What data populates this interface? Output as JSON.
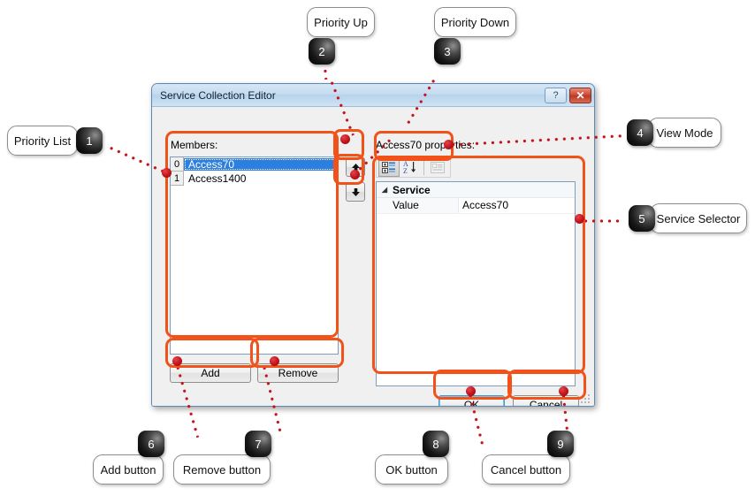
{
  "dialog": {
    "title": "Service Collection Editor",
    "help_button": "?",
    "close_button": "✕",
    "members_label": "Members:",
    "properties_label": "Access70 properties:",
    "members": [
      {
        "index": "0",
        "name": "Access70",
        "selected": true
      },
      {
        "index": "1",
        "name": "Access1400",
        "selected": false
      }
    ],
    "move_up_icon": "arrow-up-icon",
    "move_down_icon": "arrow-down-icon",
    "toolbar": {
      "categorized_icon": "categorized-view-icon",
      "alphabetical_icon": "alphabetical-sort-icon",
      "property_pages_icon": "property-pages-icon"
    },
    "property_grid": {
      "category": "Service",
      "category_triangle": "◢",
      "rows": [
        {
          "name": "Value",
          "value": "Access70"
        }
      ]
    },
    "buttons": {
      "add": "Add",
      "remove": "Remove",
      "ok": "OK",
      "cancel": "Cancel"
    }
  },
  "annotations": [
    {
      "number": "1",
      "label": "Priority List"
    },
    {
      "number": "2",
      "label": "Priority Up"
    },
    {
      "number": "3",
      "label": "Priority Down"
    },
    {
      "number": "4",
      "label": "View Mode"
    },
    {
      "number": "5",
      "label": "Service Selector"
    },
    {
      "number": "6",
      "label": "Add button"
    },
    {
      "number": "7",
      "label": "Remove button"
    },
    {
      "number": "8",
      "label": "OK button"
    },
    {
      "number": "9",
      "label": "Cancel button"
    }
  ],
  "colors": {
    "highlight_ring": "#f1521a",
    "leader_dot": "#c2121a",
    "selection": "#2a7fe0",
    "close_button": "#cf4b35"
  }
}
